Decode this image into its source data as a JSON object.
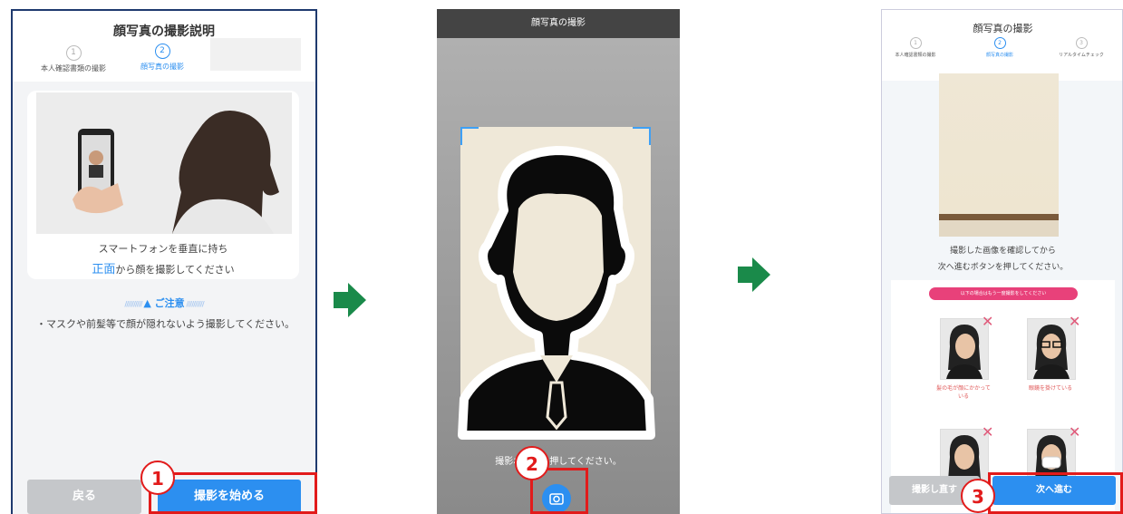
{
  "colors": {
    "accent": "#2c8ff0",
    "red": "#e21b1b",
    "arrow": "#1a8a4a",
    "navy": "#1f3a6e",
    "pink": "#e8417a"
  },
  "panel1": {
    "title": "顔写真の撮影説明",
    "steps": [
      {
        "num": "1",
        "label": "本人確認書類の撮影"
      },
      {
        "num": "2",
        "label": "顔写真の撮影"
      }
    ],
    "instruction_line1": "スマートフォンを垂直に持ち",
    "instruction_highlight": "正面",
    "instruction_line2_rest": "から顔を撮影してください",
    "caution_title": "▲ ご注意",
    "caution_text": "・マスクや前髪等で顔が隠れないよう撮影してください。",
    "back_button": "戻る",
    "start_button": "撮影を始める",
    "callout": "1"
  },
  "panel2": {
    "title": "顔写真の撮影",
    "hint": "撮影ボタンを押してください。",
    "callout": "2",
    "shutter_icon": "camera-icon"
  },
  "panel3": {
    "title": "顔写真の撮影",
    "steps": [
      {
        "num": "1",
        "label": "本人確認書類の撮影"
      },
      {
        "num": "2",
        "label": "顔写真の撮影"
      },
      {
        "num": "3",
        "label": "リアルタイムチェック"
      }
    ],
    "confirm_line1": "撮影した画像を確認してから",
    "confirm_line2": "次へ進むボタンを押してください。",
    "ng_banner": "以下の場合はもう一度撮影をしてください",
    "samples": [
      {
        "caption": "髪の毛が顔にかかっている"
      },
      {
        "caption": "眼鏡を掛けている"
      },
      {
        "caption": ""
      },
      {
        "caption": ""
      }
    ],
    "retake_button": "撮影し直す",
    "next_button": "次へ進む",
    "callout": "3"
  }
}
